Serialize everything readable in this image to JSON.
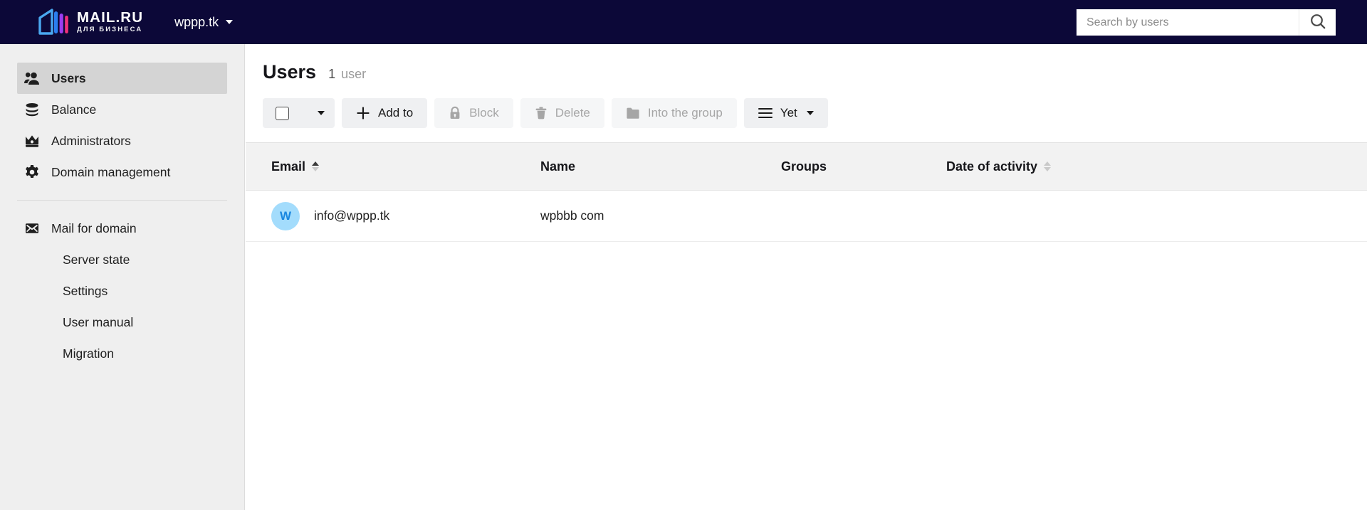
{
  "header": {
    "logo": {
      "icon": "mailru-business-logo-icon",
      "title": "MAIL.RU",
      "subtitle": "ДЛЯ БИЗНЕСА"
    },
    "domain_switcher": {
      "label": "wppp.tk",
      "caret_icon": "chevron-down-icon"
    },
    "search": {
      "placeholder": "Search by users",
      "value": "",
      "icon": "search-icon"
    },
    "background_color": "#0c0838"
  },
  "sidebar": {
    "background_color": "#efefef",
    "active_background_color": "#d4d4d4",
    "items": [
      {
        "label": "Users",
        "icon": "users-icon",
        "active": true,
        "sub": false
      },
      {
        "label": "Balance",
        "icon": "coins-icon",
        "active": false,
        "sub": false
      },
      {
        "label": "Administrators",
        "icon": "crown-icon",
        "active": false,
        "sub": false
      },
      {
        "label": "Domain management",
        "icon": "gear-icon",
        "active": false,
        "sub": false
      }
    ],
    "items2": [
      {
        "label": "Mail for domain",
        "icon": "envelope-icon",
        "active": false,
        "sub": false
      },
      {
        "label": "Server state",
        "icon": "",
        "active": false,
        "sub": true
      },
      {
        "label": "Settings",
        "icon": "",
        "active": false,
        "sub": true
      },
      {
        "label": "User manual",
        "icon": "",
        "active": false,
        "sub": true
      },
      {
        "label": "Migration",
        "icon": "",
        "active": false,
        "sub": true
      }
    ]
  },
  "main": {
    "title": "Users",
    "count_number": "1",
    "count_label": "user",
    "toolbar": {
      "select_all": {
        "icon": "checkbox-unchecked-icon",
        "caret_icon": "chevron-down-icon",
        "checked": false
      },
      "buttons": [
        {
          "label": "Add to",
          "icon": "plus-icon",
          "disabled": false,
          "caret": false
        },
        {
          "label": "Block",
          "icon": "lock-icon",
          "disabled": true,
          "caret": false
        },
        {
          "label": "Delete",
          "icon": "trash-icon",
          "disabled": true,
          "caret": false
        },
        {
          "label": "Into the group",
          "icon": "folder-icon",
          "disabled": true,
          "caret": false
        },
        {
          "label": "Yet",
          "icon": "menu-icon",
          "disabled": false,
          "caret": true
        }
      ]
    },
    "table": {
      "columns": [
        {
          "label": "Email",
          "sortable": true,
          "sort": "asc"
        },
        {
          "label": "Name",
          "sortable": false,
          "sort": "none"
        },
        {
          "label": "Groups",
          "sortable": false,
          "sort": "none"
        },
        {
          "label": "Date of activity",
          "sortable": true,
          "sort": "none"
        }
      ],
      "rows": [
        {
          "avatar_letter": "W",
          "avatar_bg": "#a3dcfc",
          "avatar_color": "#1a87e0",
          "email": "info@wppp.tk",
          "name": "wpbbb com",
          "groups": "",
          "date": ""
        }
      ]
    }
  }
}
